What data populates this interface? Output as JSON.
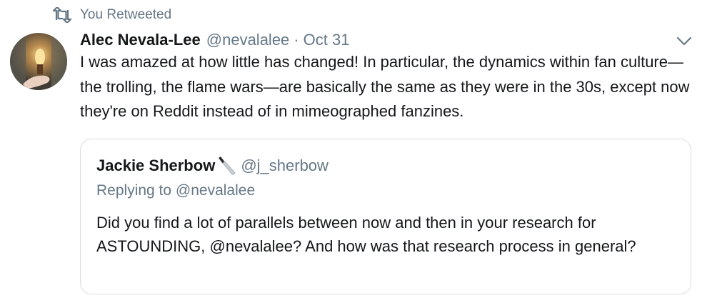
{
  "social_context": {
    "label": "You Retweeted",
    "icon": "retweet-icon"
  },
  "tweet": {
    "author_name": "Alec Nevala-Lee",
    "handle": "@nevalalee",
    "separator": "·",
    "date": "Oct 31",
    "text": "I was amazed at how little has changed! In particular, the dynamics within fan culture—the trolling, the flame wars—are basically the same as they were in the 30s, except now they're on Reddit instead of in mimeographed fanzines.",
    "menu_icon": "chevron-down-icon"
  },
  "quoted_tweet": {
    "author_name": "Jackie Sherbow",
    "emoji_icon": "knife-icon",
    "handle": "@j_sherbow",
    "replying_to": "Replying to @nevalalee",
    "text": "Did you find a lot of parallels between now and then in your research for ASTOUNDING, @nevalalee? And how was that research process in general?"
  },
  "colors": {
    "text": "#14171a",
    "secondary": "#657786",
    "border": "#d8dee2",
    "background": "#ffffff"
  }
}
